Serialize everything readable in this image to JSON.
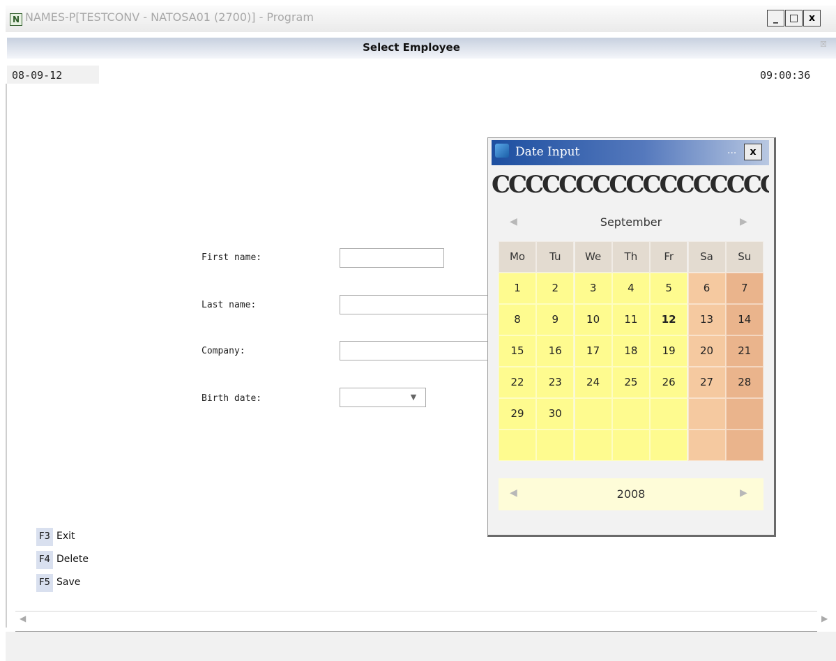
{
  "window": {
    "title": "NAMES-P[TESTCONV - NATOSA01 (2700)] - Program",
    "app_icon_letter": "N",
    "minimize": "_",
    "maximize": "□",
    "close": "x"
  },
  "screen": {
    "title": "Select Employee",
    "close": "☒",
    "date": "08-09-12",
    "time": "09:00:36"
  },
  "form": {
    "first_name_label": "First name:",
    "last_name_label": "Last name:",
    "company_label": "Company:",
    "birth_date_label": "Birth date:",
    "first_name_value": "",
    "last_name_value": "",
    "company_value": "",
    "birth_date_value": ""
  },
  "function_keys": [
    {
      "key": "F3",
      "label": "Exit"
    },
    {
      "key": "F4",
      "label": "Delete"
    },
    {
      "key": "F5",
      "label": "Save"
    }
  ],
  "date_dialog": {
    "title": "Date Input",
    "dots": "...",
    "close": "x",
    "rings": "CCCCCCCCCCCCCCCCCCCC",
    "month": "September",
    "year": "2008",
    "weekday_headers": [
      "Mo",
      "Tu",
      "We",
      "Th",
      "Fr",
      "Sa",
      "Su"
    ],
    "weeks": [
      [
        "1",
        "2",
        "3",
        "4",
        "5",
        "6",
        "7"
      ],
      [
        "8",
        "9",
        "10",
        "11",
        "12",
        "13",
        "14"
      ],
      [
        "15",
        "16",
        "17",
        "18",
        "19",
        "20",
        "21"
      ],
      [
        "22",
        "23",
        "24",
        "25",
        "26",
        "27",
        "28"
      ],
      [
        "29",
        "30",
        "",
        "",
        "",
        "",
        ""
      ],
      [
        "",
        "",
        "",
        "",
        "",
        "",
        ""
      ]
    ],
    "selected_day": "12",
    "prev_arrow": "◀",
    "next_arrow": "▶"
  },
  "scrollbar": {
    "left_arrow": "◀",
    "right_arrow": "▶"
  },
  "colors": {
    "weekday_cell": "#fefb8f",
    "saturday_cell": "#f5c9a0",
    "sunday_cell": "#eab48c",
    "header_cell": "#e3dbd0",
    "dialog_title_bar": "#1d4fa0"
  }
}
